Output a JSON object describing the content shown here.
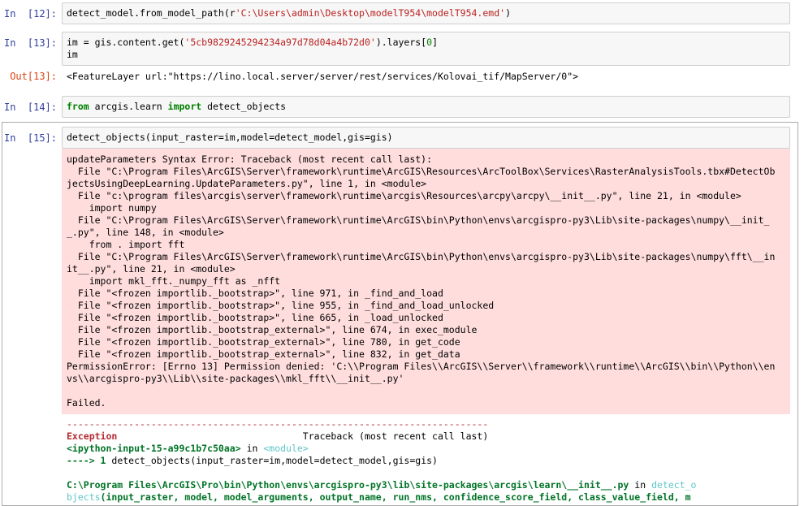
{
  "cells": {
    "c12": {
      "prompt": "In  [12]:",
      "code_a": "detect_model.from_model_path(r",
      "code_b": "'C:\\Users\\admin\\Desktop\\modelT954\\modelT954.emd'",
      "code_c": ")"
    },
    "c13": {
      "prompt": "In  [13]:",
      "line1_a": "im = gis.content.get(",
      "line1_b": "'5cb9829245294234a97d78d04a4b72d0'",
      "line1_c": ").layers[",
      "line1_d": "0",
      "line1_e": "]",
      "line2": "im"
    },
    "o13": {
      "prompt": "Out[13]:",
      "text": "<FeatureLayer url:\"https://lino.local.server/server/rest/services/Kolovai_tif/MapServer/0\">"
    },
    "c14": {
      "prompt": "In  [14]:",
      "kw1": "from",
      "mid": " arcgis.learn ",
      "kw2": "import",
      "rest": " detect_objects"
    },
    "c15": {
      "prompt": "In  [15]:",
      "code": "detect_objects(input_raster=im,model=detect_model,gis=gis)"
    }
  },
  "stderr_lines": [
    "updateParameters Syntax Error: Traceback (most recent call last):",
    "  File \"C:\\Program Files\\ArcGIS\\Server\\framework\\runtime\\ArcGIS\\Resources\\ArcToolBox\\Services\\RasterAnalysisTools.tbx#DetectOb",
    "jectsUsingDeepLearning.UpdateParameters.py\", line 1, in <module>",
    "  File \"c:\\program files\\arcgis\\server\\framework\\runtime\\arcgis\\Resources\\arcpy\\arcpy\\__init__.py\", line 21, in <module>",
    "    import numpy",
    "  File \"C:\\Program Files\\ArcGIS\\Server\\framework\\runtime\\ArcGIS\\bin\\Python\\envs\\arcgispro-py3\\Lib\\site-packages\\numpy\\__init_",
    "_.py\", line 148, in <module>",
    "    from . import fft",
    "  File \"C:\\Program Files\\ArcGIS\\Server\\framework\\runtime\\ArcGIS\\bin\\Python\\envs\\arcgispro-py3\\Lib\\site-packages\\numpy\\fft\\__in",
    "it__.py\", line 21, in <module>",
    "    import mkl_fft._numpy_fft as _nfft",
    "  File \"<frozen importlib._bootstrap>\", line 971, in _find_and_load",
    "  File \"<frozen importlib._bootstrap>\", line 955, in _find_and_load_unlocked",
    "  File \"<frozen importlib._bootstrap>\", line 665, in _load_unlocked",
    "  File \"<frozen importlib._bootstrap_external>\", line 674, in exec_module",
    "  File \"<frozen importlib._bootstrap_external>\", line 780, in get_code",
    "  File \"<frozen importlib._bootstrap_external>\", line 832, in get_data",
    "PermissionError: [Errno 13] Permission denied: 'C:\\\\Program Files\\\\ArcGIS\\\\Server\\\\framework\\\\runtime\\\\ArcGIS\\\\bin\\\\Python\\\\en",
    "vs\\\\arcgispro-py3\\\\Lib\\\\site-packages\\\\mkl_fft\\\\__init__.py'",
    "",
    "Failed."
  ],
  "traceback": {
    "rule": "---------------------------------------------------------------------------",
    "exc_name": "Exception",
    "exc_pad": "                                 ",
    "exc_title": "Traceback (most recent call last)",
    "ipy_ref": "<ipython-input-15-a99c1b7c50aa>",
    "in_word": " in ",
    "module_ref": "<module>",
    "arrow": "----> 1 ",
    "arrow_code": "detect_objects(input_raster=im,model=detect_model,gis=gis)",
    "path": "C:\\Program Files\\ArcGIS\\Pro\\bin\\Python\\envs\\arcgispro-py3\\lib\\site-packages\\arcgis\\learn\\__init__.py",
    "path_in": " in ",
    "func_a": "detect_o",
    "func_b": "bjects",
    "sig": "(input_raster, model, model_arguments, output_name, run_nms, confidence_score_field, class_value_field, m"
  }
}
